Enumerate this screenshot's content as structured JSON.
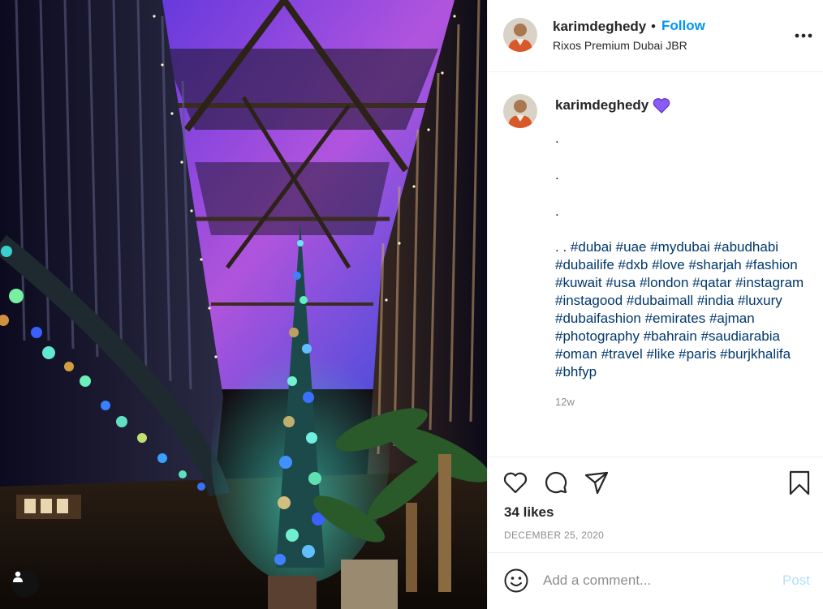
{
  "post": {
    "username": "karimdeghedy",
    "follow_label": "Follow",
    "separator": "•",
    "location": "Rixos Premium Dubai JBR"
  },
  "caption": {
    "username": "karimdeghedy",
    "dots": [
      ".",
      ".",
      "."
    ],
    "lead": ". .",
    "hashtags": "#dubai #uae #mydubai #abudhabi #dubailife #dxb #love #sharjah #fashion #kuwait #usa #london #qatar #instagram #instagood #dubaimall #india #luxury #dubaifashion #emirates #ajman #photography #bahrain #saudiarabia #oman #travel #like #paris #burjkhalifa #bhfyp",
    "time_ago": "12w"
  },
  "engagement": {
    "likes": "34 likes",
    "date": "DECEMBER 25, 2020"
  },
  "comment": {
    "placeholder": "Add a comment...",
    "post_label": "Post"
  },
  "colors": {
    "accent": "#0095f6",
    "hashtag": "#00376b",
    "muted": "#8e8e8e",
    "heart_purple": "#8a5cf5"
  },
  "icons": [
    "user-tag-icon",
    "more-options-icon",
    "purple-heart-icon",
    "like-icon",
    "comment-icon",
    "share-icon",
    "save-icon",
    "emoji-icon"
  ]
}
